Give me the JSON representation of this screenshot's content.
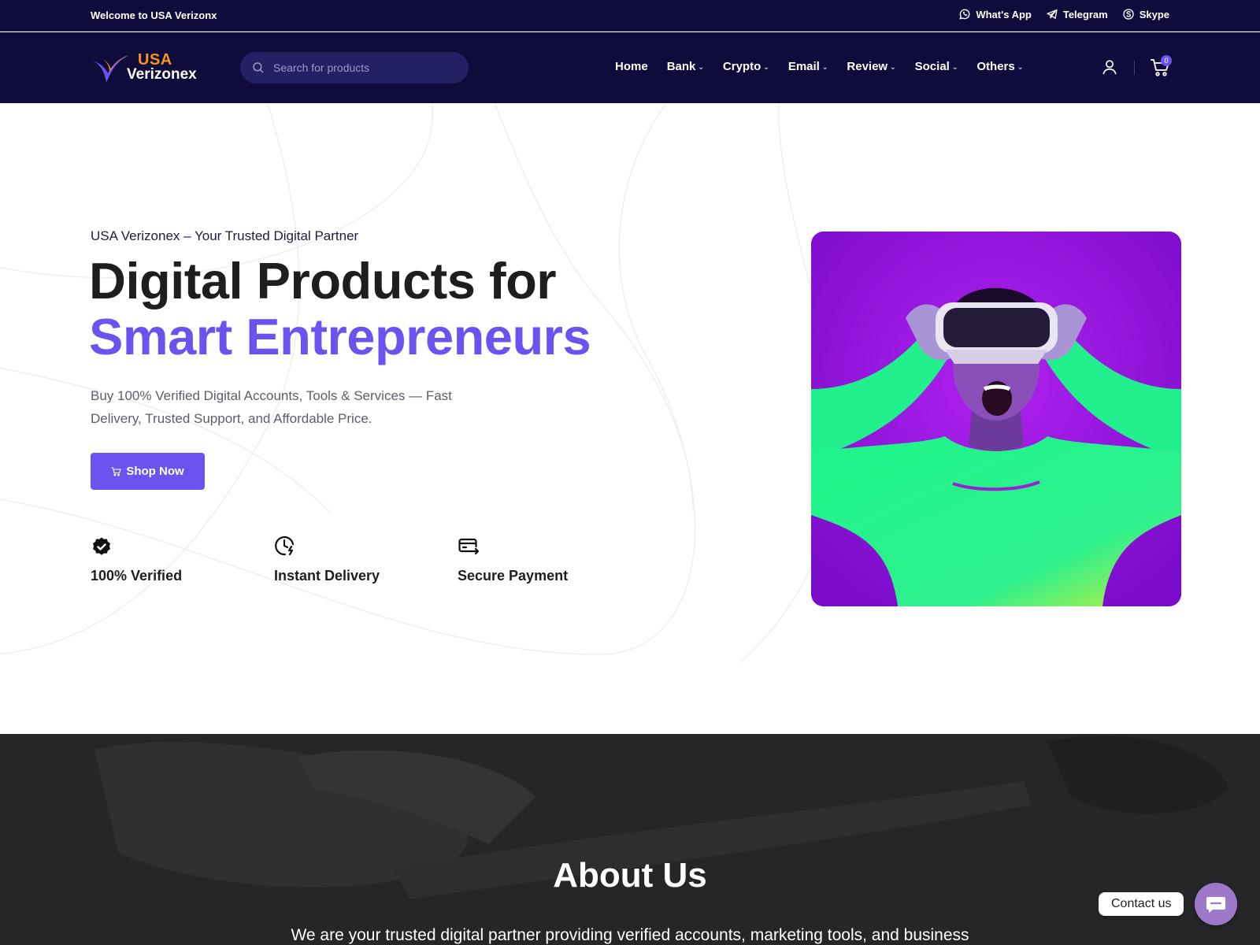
{
  "topbar": {
    "welcome": "Welcome to USA Verizonx",
    "contacts": [
      {
        "label": "What's App",
        "icon": "whatsapp-icon"
      },
      {
        "label": "Telegram",
        "icon": "telegram-icon"
      },
      {
        "label": "Skype",
        "icon": "skype-icon"
      }
    ]
  },
  "header": {
    "logo": {
      "top": "USA",
      "bottom": "Verizonex"
    },
    "search_placeholder": "Search for products",
    "nav": [
      {
        "label": "Home",
        "has_dropdown": false
      },
      {
        "label": "Bank",
        "has_dropdown": true
      },
      {
        "label": "Crypto",
        "has_dropdown": true
      },
      {
        "label": "Email",
        "has_dropdown": true
      },
      {
        "label": "Review",
        "has_dropdown": true
      },
      {
        "label": "Social",
        "has_dropdown": true
      },
      {
        "label": "Others",
        "has_dropdown": true
      }
    ],
    "cart_count": "0"
  },
  "hero": {
    "tagline": "USA Verizonex – Your Trusted Digital Partner",
    "headline_line1": "Digital Products for",
    "headline_line2": "Smart Entrepreneurs",
    "subtitle": "Buy 100% Verified Digital Accounts, Tools & Services — Fast Delivery, Trusted Support, and Affordable Price.",
    "cta": "Shop Now",
    "features": [
      {
        "label": "100% Verified",
        "icon": "verified-badge-icon"
      },
      {
        "label": "Instant Delivery",
        "icon": "clock-bolt-icon"
      },
      {
        "label": "Secure Payment",
        "icon": "card-payment-icon"
      }
    ]
  },
  "about": {
    "title": "About Us",
    "text": "We are your trusted digital partner providing verified accounts, marketing tools, and business"
  },
  "floating": {
    "contact_label": "Contact us"
  },
  "colors": {
    "navy": "#0f0c3b",
    "accent": "#6c52ef",
    "logo_orange": "#f7941d"
  }
}
